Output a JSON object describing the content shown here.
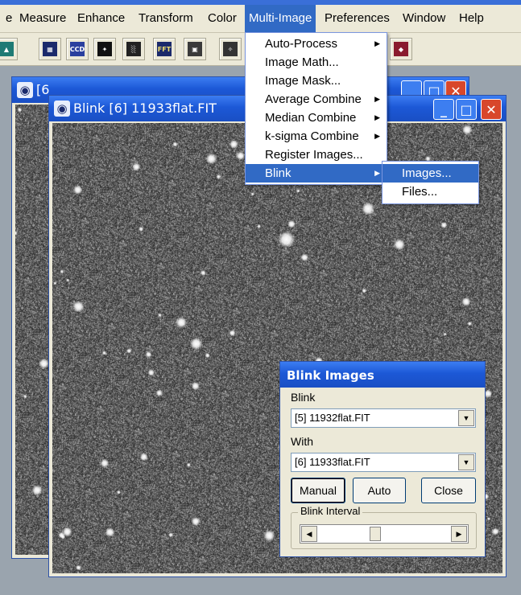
{
  "menubar": {
    "items": [
      {
        "label": "e"
      },
      {
        "label": "Measure"
      },
      {
        "label": "Enhance"
      },
      {
        "label": "Transform"
      },
      {
        "label": "Color"
      },
      {
        "label": "Multi-Image",
        "active": true
      },
      {
        "label": "Preferences"
      },
      {
        "label": "Window"
      },
      {
        "label": "Help"
      }
    ]
  },
  "toolbar": {
    "buttons": [
      {
        "icon": "histogram-icon",
        "glyph": "▲"
      },
      {
        "icon": "stack-icon",
        "glyph": "▦"
      },
      {
        "icon": "ccd-icon",
        "glyph": "CCD"
      },
      {
        "icon": "star-icon",
        "glyph": "✦"
      },
      {
        "icon": "noise-icon",
        "glyph": "░"
      },
      {
        "icon": "fft-icon",
        "glyph": "FFT"
      },
      {
        "icon": "grid-icon",
        "glyph": "▣"
      },
      {
        "icon": "star-field-icon",
        "glyph": "✧"
      },
      {
        "icon": "book-icon",
        "glyph": "◆"
      }
    ]
  },
  "windows": {
    "back": {
      "title": "[6] 11932flat.FIT",
      "title_visible": "[6"
    },
    "front": {
      "title": "Blink [6] 11933flat.FIT"
    }
  },
  "multi_image_menu": {
    "items": [
      {
        "label": "Auto-Process",
        "submenu": true
      },
      {
        "label": "Image Math...",
        "submenu": false
      },
      {
        "label": "Image Mask...",
        "submenu": false
      },
      {
        "label": "Average Combine",
        "submenu": true
      },
      {
        "label": "Median Combine",
        "submenu": true
      },
      {
        "label": "k-sigma Combine",
        "submenu": true
      },
      {
        "label": "Register Images...",
        "submenu": false
      },
      {
        "label": "Blink",
        "submenu": true,
        "highlighted": true
      }
    ]
  },
  "blink_submenu": {
    "items": [
      {
        "label": "Images...",
        "highlighted": true
      },
      {
        "label": "Files..."
      }
    ]
  },
  "blink_dialog": {
    "title": "Blink Images",
    "blink_label": "Blink",
    "blink_value": "[5] 11932flat.FIT",
    "with_label": "With",
    "with_value": "[6] 11933flat.FIT",
    "manual_label": "Manual",
    "auto_label": "Auto",
    "close_label": "Close",
    "interval_label": "Blink Interval",
    "interval_position": 0.43
  },
  "colors": {
    "title_bar": "#1c58d6",
    "menu_highlight": "#316ac5",
    "close_button": "#d8472b",
    "dialog_bg": "#ece9d8"
  }
}
